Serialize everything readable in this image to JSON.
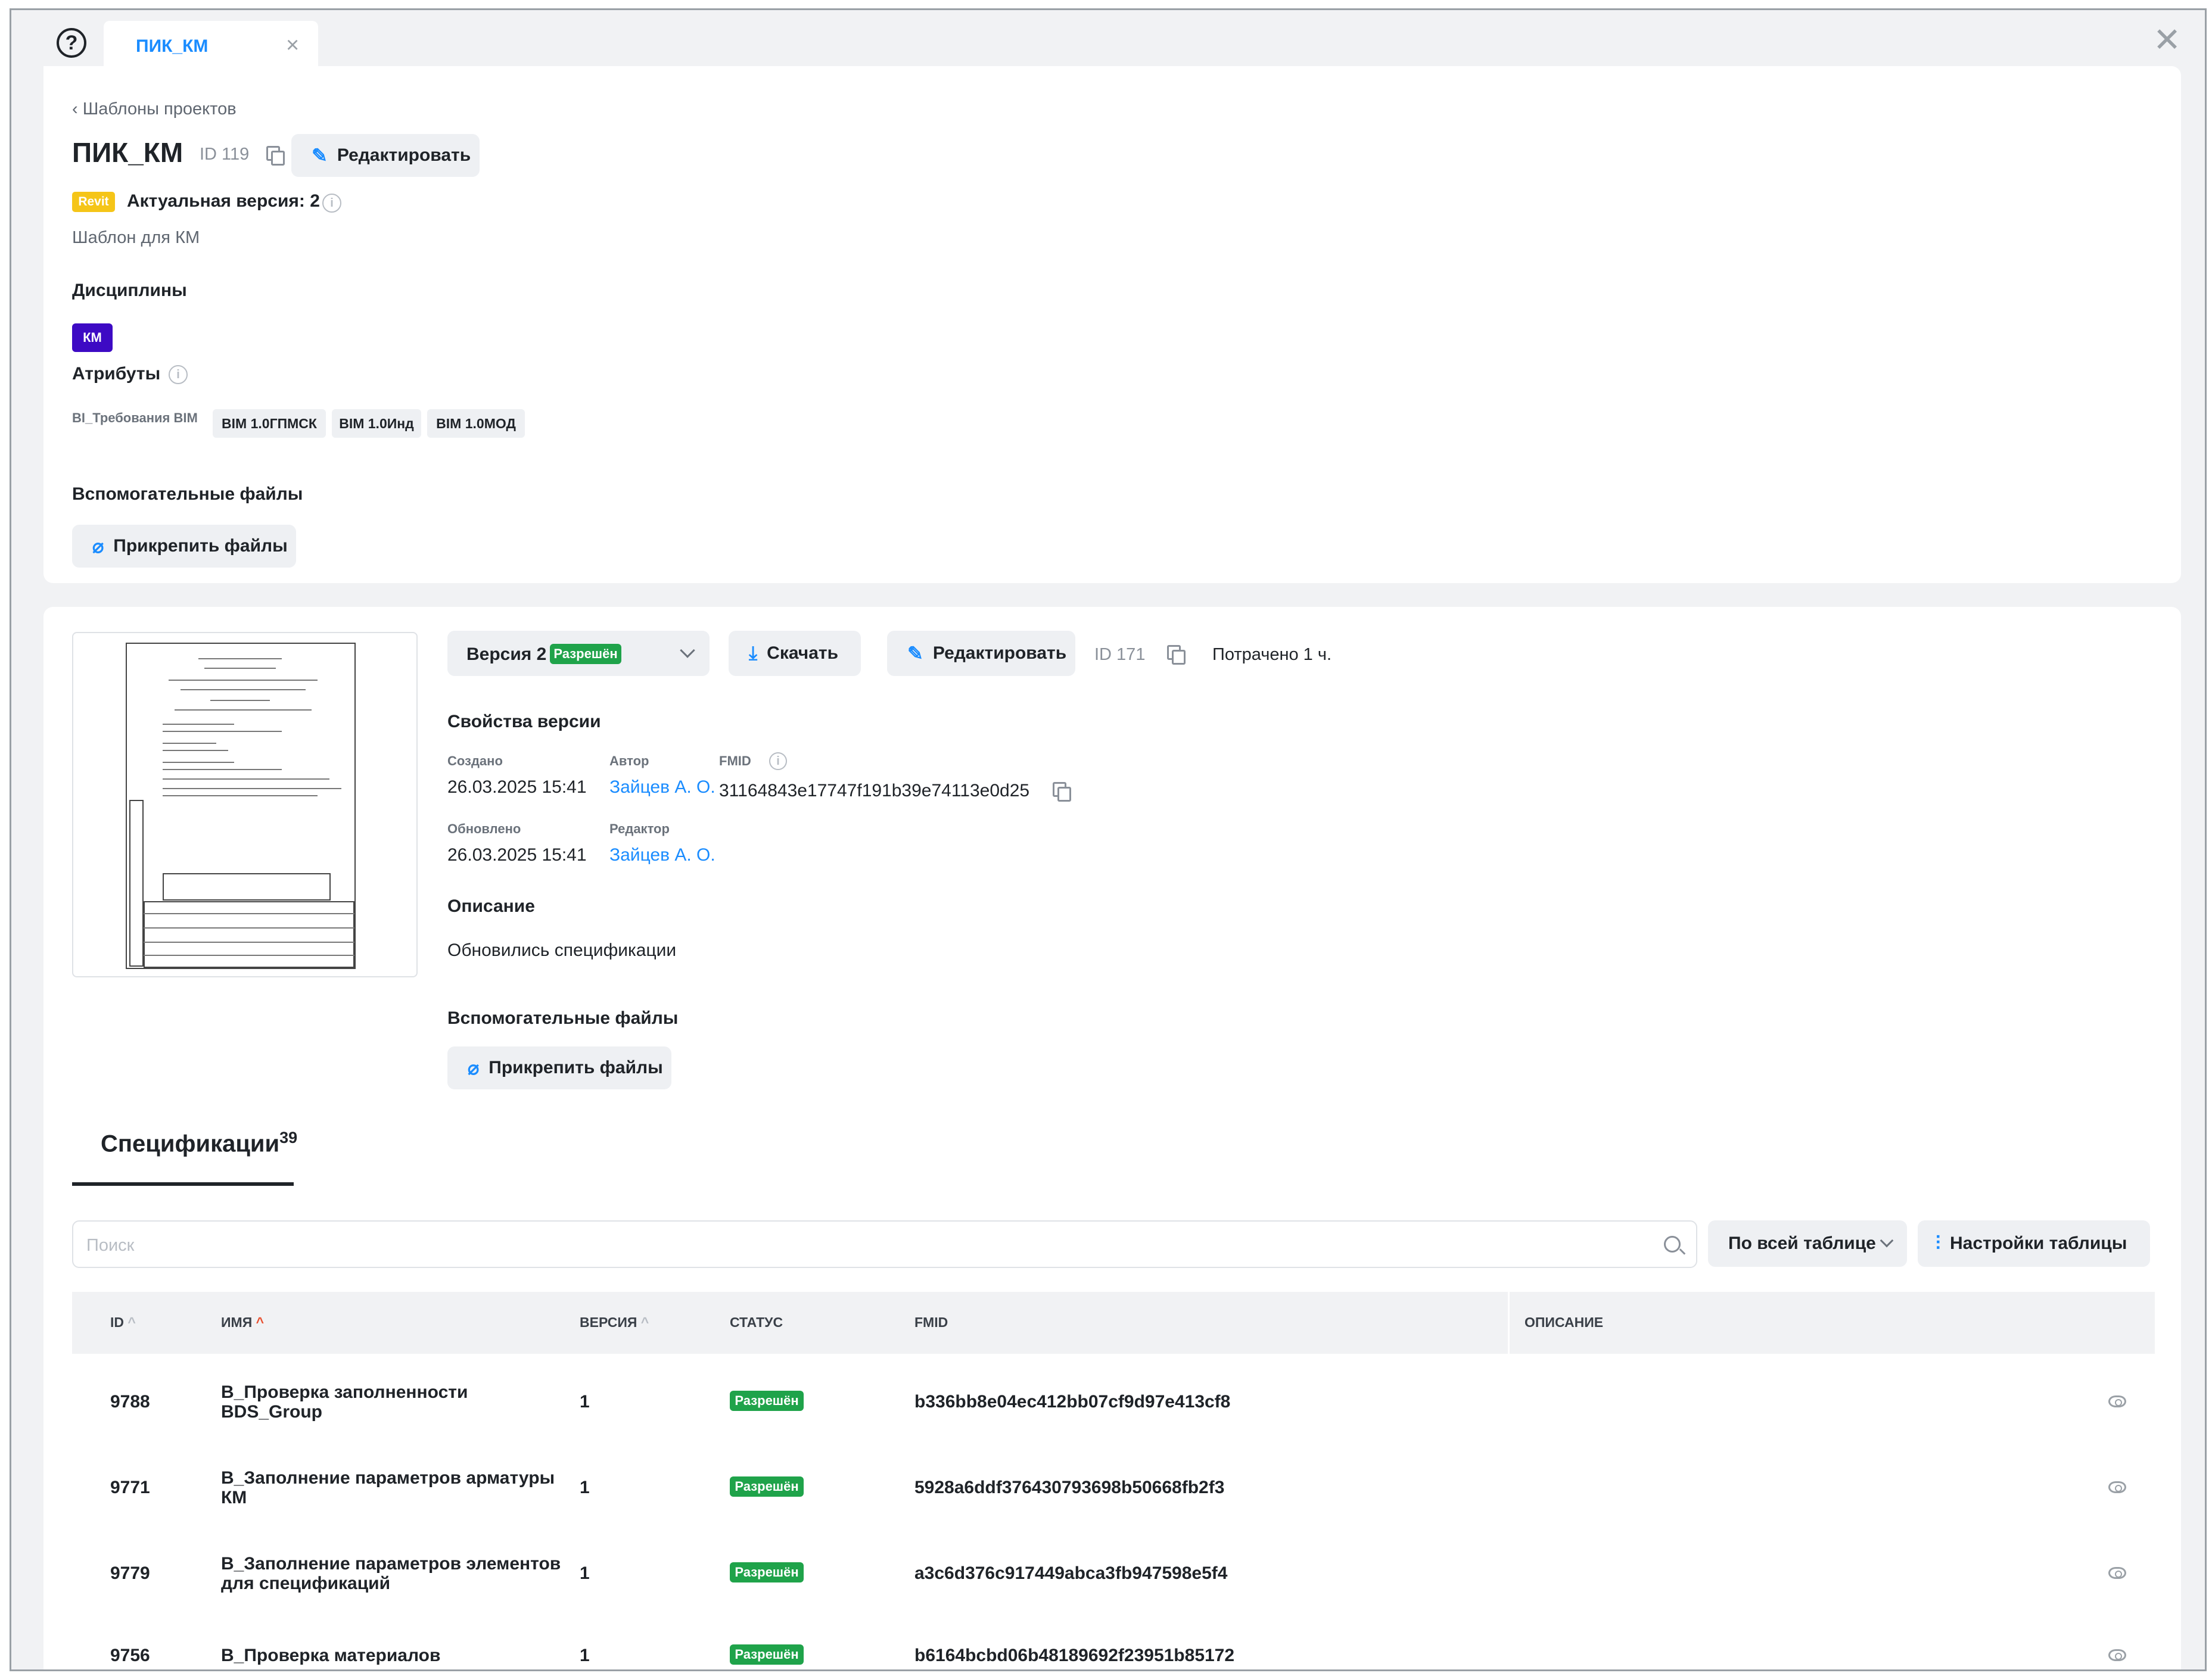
{
  "tab": {
    "label": "ПИК_КМ"
  },
  "header": {
    "breadcrumb": "‹ Шаблоны проектов",
    "title": "ПИК_КМ",
    "id_text": "ID 119",
    "edit_button": "Редактировать",
    "revit_badge": "Revit",
    "actual_version": "Актуальная версия: 2",
    "description": "Шаблон для КМ"
  },
  "disciplines": {
    "label": "Дисциплины",
    "items": [
      "КМ"
    ]
  },
  "attributes": {
    "label": "Атрибуты",
    "key": "BI_Требования BIM",
    "values": [
      "BIM 1.0ГПМСК",
      "BIM 1.0Инд",
      "BIM 1.0МОД"
    ]
  },
  "aux_files_top": {
    "label": "Вспомогательные файлы",
    "attach_button": "Прикрепить файлы"
  },
  "version": {
    "select_label": "Версия 2",
    "select_status": "Разрешён",
    "download_button": "Скачать",
    "edit_button": "Редактировать",
    "id_text": "ID 171",
    "spent": "Потрачено 1 ч.",
    "props_title": "Свойства версии",
    "created_label": "Создано",
    "created_value": "26.03.2025 15:41",
    "author_label": "Автор",
    "author_value": "Зайцев А. О.",
    "fmid_label": "FMID",
    "fmid_value": "31164843e17747f191b39e74113e0d25",
    "updated_label": "Обновлено",
    "updated_value": "26.03.2025 15:41",
    "editor_label": "Редактор",
    "editor_value": "Зайцев А. О.",
    "description_title": "Описание",
    "description_value": "Обновились спецификации",
    "aux_files_label": "Вспомогательные файлы",
    "attach_button": "Прикрепить файлы"
  },
  "specs_tab": {
    "label": "Спецификации",
    "count": "39"
  },
  "search": {
    "placeholder": "Поиск",
    "scope": "По всей таблице",
    "settings_button": "Настройки таблицы"
  },
  "table": {
    "headers": {
      "id": "ID",
      "name": "ИМЯ",
      "version": "ВЕРСИЯ",
      "status": "СТАТУС",
      "fmid": "FMID",
      "description": "ОПИСАНИЕ"
    },
    "rows": [
      {
        "id": "9788",
        "name_line1": "B_Проверка заполненности",
        "name_line2": "BDS_Group",
        "version": "1",
        "status": "Разрешён",
        "fmid": "b336bb8e04ec412bb07cf9d97e413cf8"
      },
      {
        "id": "9771",
        "name_line1": "B_Заполнение параметров арматуры",
        "name_line2": "КМ",
        "version": "1",
        "status": "Разрешён",
        "fmid": "5928a6ddf376430793698b50668fb2f3"
      },
      {
        "id": "9779",
        "name_line1": "B_Заполнение параметров элементов",
        "name_line2": "для спецификаций",
        "version": "1",
        "status": "Разрешён",
        "fmid": "a3c6d376c917449abca3fb947598e5f4"
      },
      {
        "id": "9756",
        "name_line1": "B_Проверка материалов",
        "name_line2": "",
        "version": "1",
        "status": "Разрешён",
        "fmid": "b6164bcbd06b48189692f23951b85172"
      }
    ]
  },
  "colors": {
    "accent": "#1a8cff",
    "success": "#1fa34a",
    "revit": "#f5c518",
    "discipline": "#3d0ac4",
    "sort_active": "#e8502f"
  }
}
